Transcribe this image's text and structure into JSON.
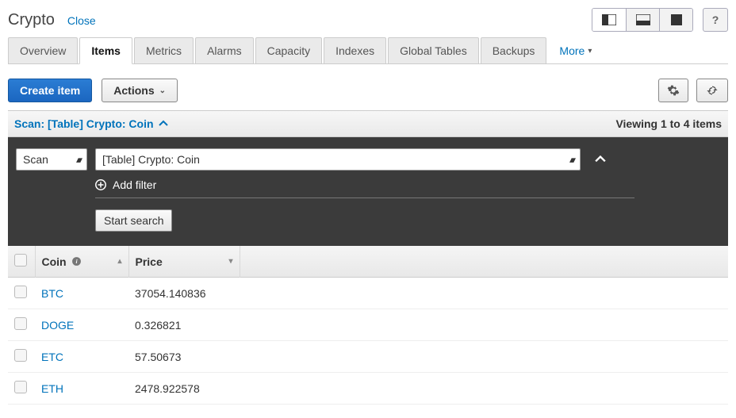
{
  "header": {
    "title": "Crypto",
    "close": "Close"
  },
  "tabs": [
    {
      "label": "Overview"
    },
    {
      "label": "Items"
    },
    {
      "label": "Metrics"
    },
    {
      "label": "Alarms"
    },
    {
      "label": "Capacity"
    },
    {
      "label": "Indexes"
    },
    {
      "label": "Global Tables"
    },
    {
      "label": "Backups"
    }
  ],
  "more": "More",
  "toolbar": {
    "create": "Create item",
    "actions": "Actions"
  },
  "scan": {
    "label": "Scan: [Table] Crypto: Coin",
    "viewing": "Viewing 1 to 4 items",
    "mode": "Scan",
    "scope": "[Table] Crypto: Coin",
    "add_filter": "Add filter",
    "start": "Start search"
  },
  "columns": {
    "coin": "Coin",
    "price": "Price"
  },
  "rows": [
    {
      "coin": "BTC",
      "price": "37054.140836"
    },
    {
      "coin": "DOGE",
      "price": "0.326821"
    },
    {
      "coin": "ETC",
      "price": "57.50673"
    },
    {
      "coin": "ETH",
      "price": "2478.922578"
    }
  ]
}
